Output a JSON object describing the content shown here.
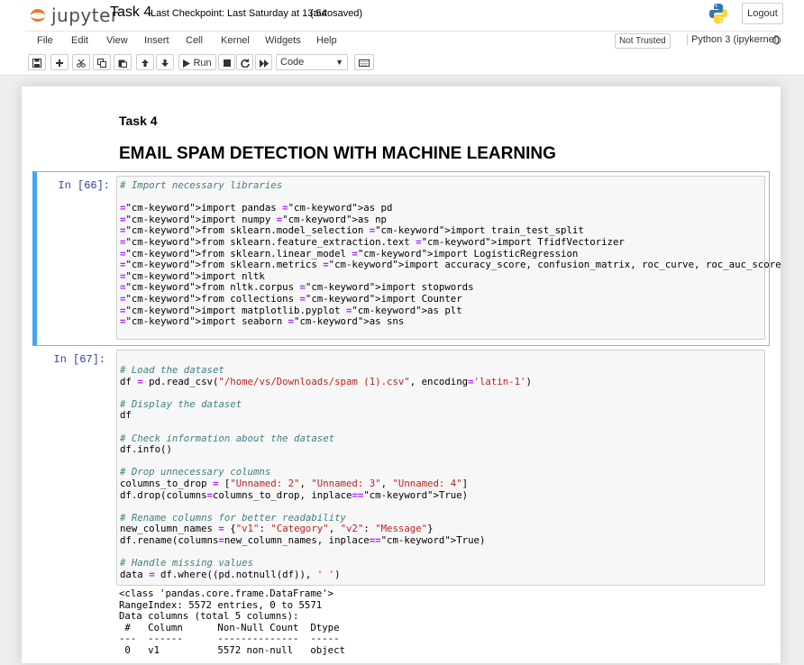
{
  "header": {
    "logo_text": "jupyter",
    "notebook_title": "Task 4",
    "checkpoint": "Last Checkpoint: Last Saturday at 13:54",
    "autosave_status": "(autosaved)",
    "logout_label": "Logout"
  },
  "menu": {
    "items": [
      "File",
      "Edit",
      "View",
      "Insert",
      "Cell",
      "Kernel",
      "Widgets",
      "Help"
    ],
    "trust_status": "Not Trusted",
    "kernel_name": "Python 3 (ipykernel)"
  },
  "toolbar": {
    "run_label": "Run",
    "cell_type": "Code",
    "buttons": [
      "save-icon",
      "plus-icon",
      "scissors-icon",
      "copy-icon",
      "paste-icon",
      "arrow-up-icon",
      "arrow-down-icon",
      "play-icon",
      "stop-icon",
      "restart-icon",
      "fast-forward-icon",
      "keyboard-icon"
    ]
  },
  "markdown": {
    "h3": "Task 4",
    "h1": "EMAIL SPAM DETECTION WITH MACHINE LEARNING"
  },
  "cells": [
    {
      "prompt": "In [66]:",
      "code": [
        "# Import necessary libraries",
        "",
        "import pandas as pd",
        "import numpy as np",
        "from sklearn.model_selection import train_test_split",
        "from sklearn.feature_extraction.text import TfidfVectorizer",
        "from sklearn.linear_model import LogisticRegression",
        "from sklearn.metrics import accuracy_score, confusion_matrix, roc_curve, roc_auc_score",
        "import nltk",
        "from nltk.corpus import stopwords",
        "from collections import Counter",
        "import matplotlib.pyplot as plt",
        "import seaborn as sns"
      ]
    },
    {
      "prompt": "In [67]:",
      "code": [
        "# Load the dataset",
        "df = pd.read_csv(\"/home/vs/Downloads/spam (1).csv\", encoding='latin-1')",
        "",
        "# Display the dataset",
        "df",
        "",
        "# Check information about the dataset",
        "df.info()",
        "",
        "# Drop unnecessary columns",
        "columns_to_drop = [\"Unnamed: 2\", \"Unnamed: 3\", \"Unnamed: 4\"]",
        "df.drop(columns=columns_to_drop, inplace=True)",
        "",
        "# Rename columns for better readability",
        "new_column_names = {\"v1\": \"Category\", \"v2\": \"Message\"}",
        "df.rename(columns=new_column_names, inplace=True)",
        "",
        "# Handle missing values",
        "data = df.where((pd.notnull(df)), ' ')"
      ],
      "output": [
        "<class 'pandas.core.frame.DataFrame'>",
        "RangeIndex: 5572 entries, 0 to 5571",
        "Data columns (total 5 columns):",
        " #   Column      Non-Null Count  Dtype ",
        "---  ------      --------------  ----- ",
        " 0   v1          5572 non-null   object"
      ]
    }
  ]
}
